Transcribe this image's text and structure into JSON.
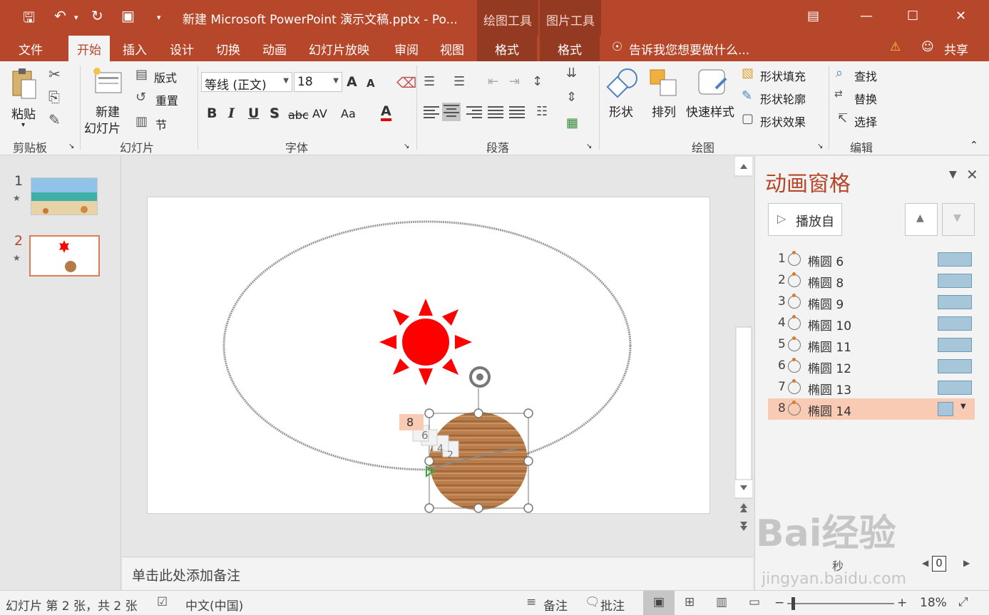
{
  "titlebar": {
    "title": "新建 Microsoft PowerPoint 演示文稿.pptx - Po...",
    "context_tab_drawing": "绘图工具",
    "context_tab_picture": "图片工具"
  },
  "tabs": {
    "file": "文件",
    "home": "开始",
    "insert": "插入",
    "design": "设计",
    "transitions": "切换",
    "animations": "动画",
    "slideshow": "幻灯片放映",
    "review": "审阅",
    "view": "视图",
    "format1": "格式",
    "format2": "格式",
    "tell_me": "告诉我您想要做什么...",
    "share": "共享"
  },
  "ribbon": {
    "clipboard": {
      "paste": "粘贴",
      "label": "剪贴板"
    },
    "slides": {
      "new_slide_1": "新建",
      "new_slide_2": "幻灯片",
      "layout": "版式",
      "reset": "重置",
      "section": "节",
      "label": "幻灯片"
    },
    "font": {
      "font_name": "等线 (正文)",
      "font_size": "18",
      "bold": "B",
      "italic": "I",
      "underline": "U",
      "shadow": "S",
      "strike": "abc",
      "spacing": "AV",
      "case": "Aa",
      "color": "A",
      "grow": "A",
      "shrink": "A",
      "label": "字体"
    },
    "paragraph": {
      "label": "段落"
    },
    "drawing": {
      "shapes": "形状",
      "arrange": "排列",
      "quick_styles": "快速样式",
      "shape_fill": "形状填充",
      "shape_outline": "形状轮廓",
      "shape_effects": "形状效果",
      "label": "绘图"
    },
    "editing": {
      "find": "查找",
      "replace": "替换",
      "select": "选择",
      "label": "编辑"
    }
  },
  "thumbnails": [
    {
      "num": "1",
      "star": "★"
    },
    {
      "num": "2",
      "star": "★"
    }
  ],
  "slide": {
    "tags": [
      "8",
      "6",
      "4",
      "2"
    ]
  },
  "notes": {
    "placeholder": "单击此处添加备注"
  },
  "anim_pane": {
    "title": "动画窗格",
    "play_label": "播放自",
    "items": [
      {
        "num": "1",
        "name": "椭圆 6"
      },
      {
        "num": "2",
        "name": "椭圆 8"
      },
      {
        "num": "3",
        "name": "椭圆 9"
      },
      {
        "num": "4",
        "name": "椭圆 10"
      },
      {
        "num": "5",
        "name": "椭圆 11"
      },
      {
        "num": "6",
        "name": "椭圆 12"
      },
      {
        "num": "7",
        "name": "椭圆 13"
      },
      {
        "num": "8",
        "name": "椭圆 14"
      }
    ],
    "seconds_label": "秒",
    "seconds_value": "0"
  },
  "statusbar": {
    "slide_info": "幻灯片 第 2 张，共 2 张",
    "language": "中文(中国)",
    "notes": "备注",
    "comments": "批注",
    "zoom": "18%"
  },
  "watermark": {
    "main": "Bai经验",
    "sub": "jingyan.baidu.com"
  },
  "colors": {
    "accent": "#b7472a",
    "sun": "#ff0000",
    "selected_row": "#f9cbb5",
    "timeline_bar": "#a7c6da"
  }
}
